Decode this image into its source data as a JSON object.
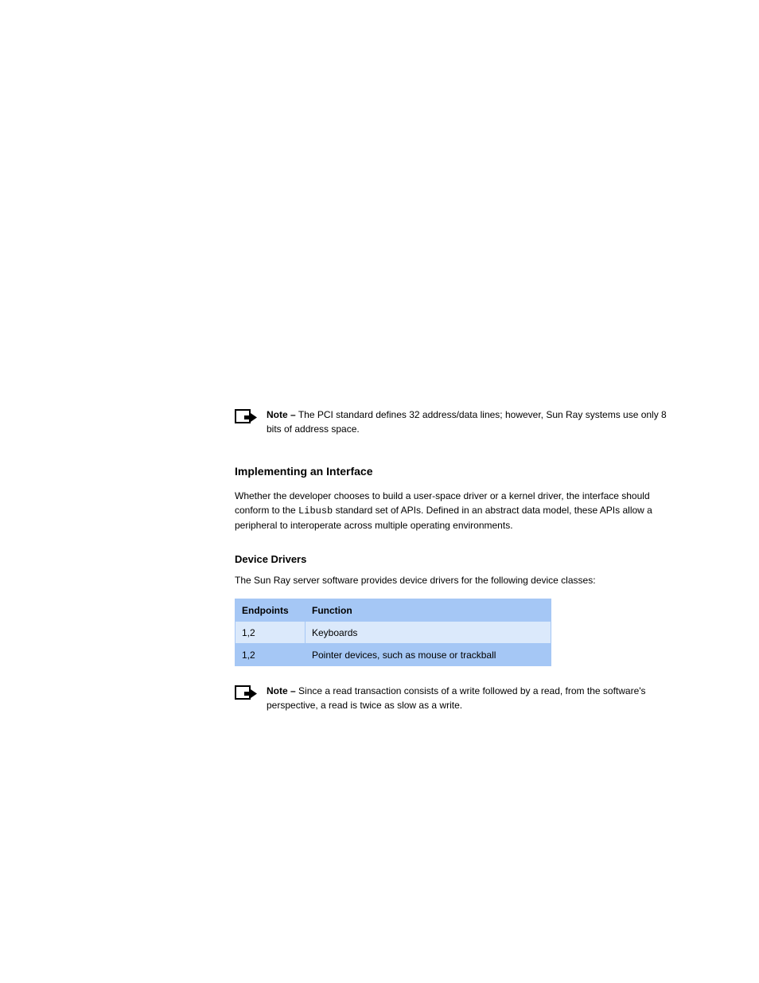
{
  "notes": {
    "note1": {
      "strong": "Note –",
      "text": "The PCI standard defines 32 address/data lines; however, Sun Ray systems use only 8 bits of address space."
    },
    "note2": {
      "strong": "Note –",
      "text": "Since a read transaction consists of a write followed by a read, from the software's perspective, a read is twice as slow as a write."
    }
  },
  "section": {
    "heading": "Implementing an Interface",
    "p1_pre": "Whether the developer chooses to build a user-space driver or a kernel driver, the interface should conform to the ",
    "p1_code": "Libusb",
    "p1_post": " standard set of APIs. Defined in an abstract data model, these APIs allow a peripheral to interoperate across multiple operating environments."
  },
  "sub": {
    "heading": "Device Drivers",
    "p1": "The Sun Ray server software provides device drivers for the following device classes:",
    "table": {
      "h0": "Endpoints",
      "h1": "Function",
      "rows": [
        {
          "c0": "1,2",
          "c1": "Keyboards"
        },
        {
          "c0": "1,2",
          "c1": "Pointer devices, such as mouse or trackball"
        }
      ]
    }
  }
}
